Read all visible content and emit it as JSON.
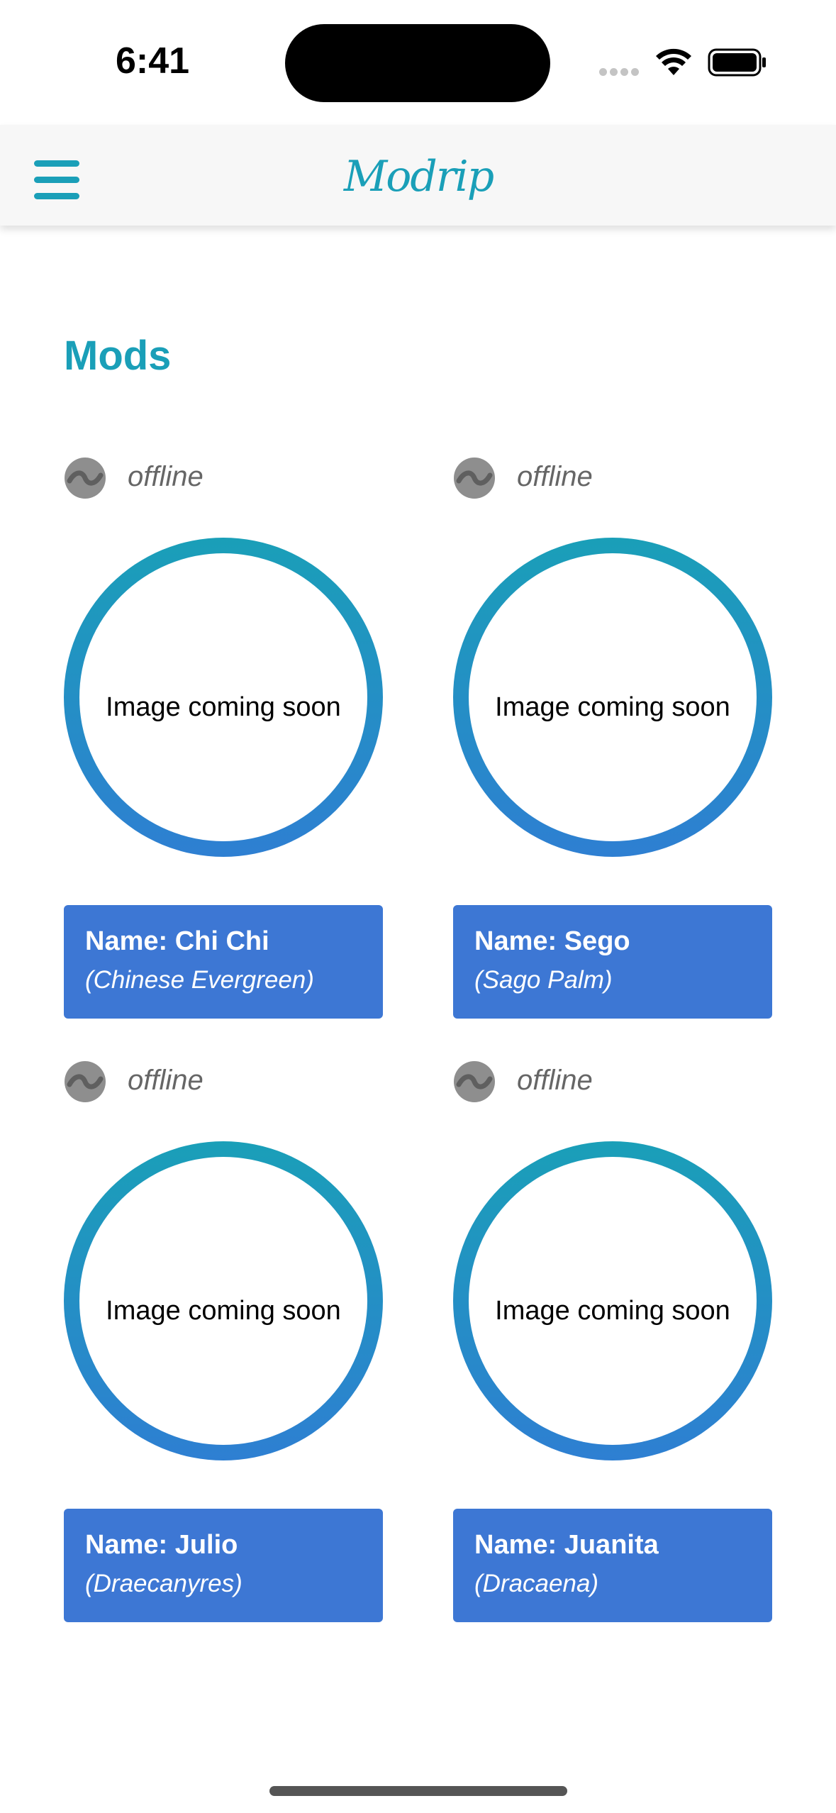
{
  "status_bar": {
    "time": "6:41"
  },
  "header": {
    "brand": "Modrip",
    "menu_icon": "hamburger-menu-icon",
    "accent_color": "#1a9fb8"
  },
  "page": {
    "title": "Mods"
  },
  "placeholder_text": "Image coming soon",
  "mods": [
    {
      "status": "offline",
      "name": "Name: Chi Chi",
      "species": "(Chinese Evergreen)"
    },
    {
      "status": "offline",
      "name": "Name: Sego",
      "species": "(Sago Palm)"
    },
    {
      "status": "offline",
      "name": "Name: Julio",
      "species": "(Draecanyres)"
    },
    {
      "status": "offline",
      "name": "Name: Juanita",
      "species": "(Dracaena)"
    }
  ],
  "colors": {
    "card_background": "#3d77d4",
    "ring_start": "#1a9fb8",
    "ring_end": "#2e7fd2",
    "status_text": "#666666"
  }
}
